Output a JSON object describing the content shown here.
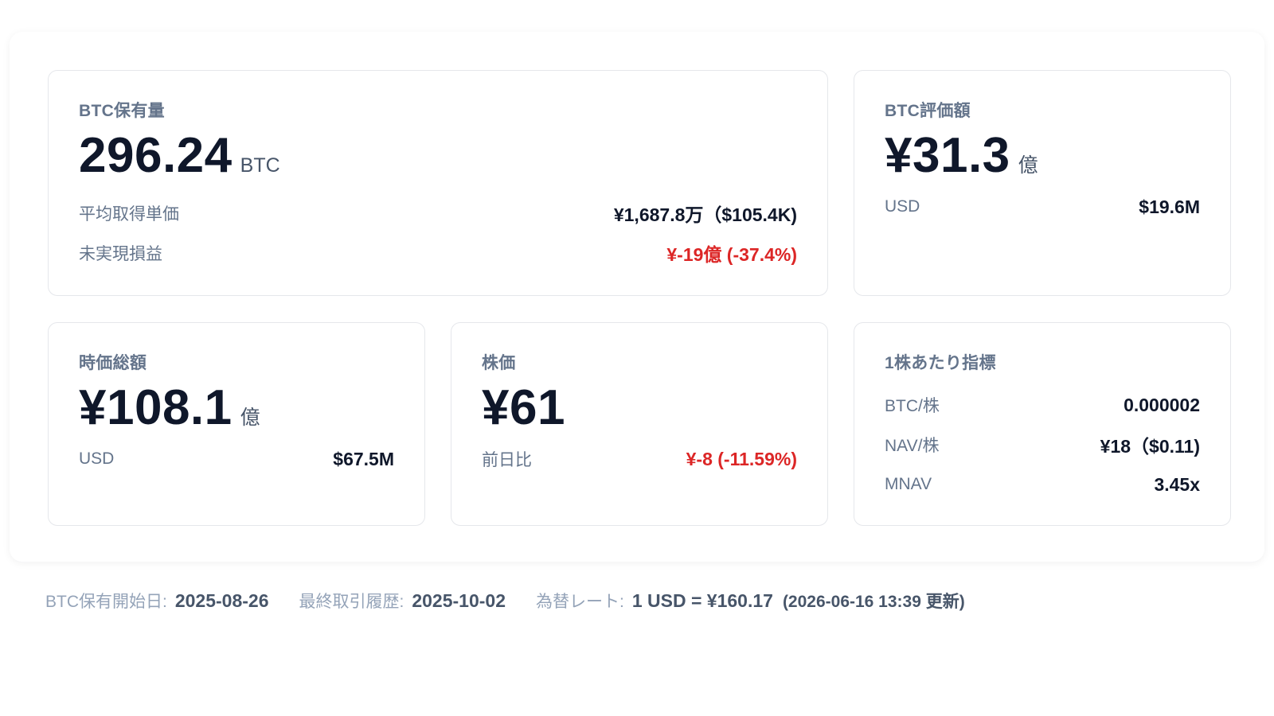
{
  "holdings": {
    "title": "BTC保有量",
    "value": "296.24",
    "unit": "BTC",
    "avg_cost_label": "平均取得単価",
    "avg_cost_value": "¥1,687.8万（$105.4K)",
    "unrealized_label": "未実現損益",
    "unrealized_value": "¥-19億 (-37.4%)"
  },
  "btc_value": {
    "title": "BTC評価額",
    "value": "¥31.3",
    "unit": "億",
    "usd_label": "USD",
    "usd_value": "$19.6M"
  },
  "market_cap": {
    "title": "時価総額",
    "value": "¥108.1",
    "unit": "億",
    "usd_label": "USD",
    "usd_value": "$67.5M"
  },
  "stock_price": {
    "title": "株価",
    "value": "¥61",
    "change_label": "前日比",
    "change_value": "¥-8 (-11.59%)"
  },
  "per_share": {
    "title": "1株あたり指標",
    "rows": [
      {
        "label": "BTC/株",
        "value": "0.000002"
      },
      {
        "label": "NAV/株",
        "value": "¥18（$0.11)"
      },
      {
        "label": "MNAV",
        "value": "3.45x"
      }
    ]
  },
  "footer": {
    "start_label": "BTC保有開始日:",
    "start_value": "2025-08-26",
    "last_trade_label": "最終取引履歴:",
    "last_trade_value": "2025-10-02",
    "fx_label": "為替レート:",
    "fx_value": "1 USD = ¥160.17",
    "fx_note": "(2026-06-16 13:39 更新)"
  },
  "colors": {
    "negative": "#dc2626",
    "primary_text": "#0f172a",
    "muted_text": "#64748b"
  }
}
